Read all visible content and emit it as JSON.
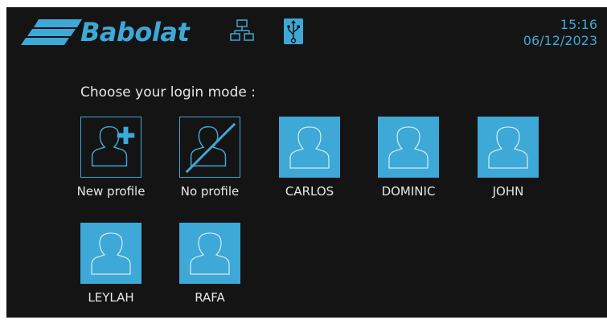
{
  "header": {
    "brand": "Babolat",
    "time": "15:16",
    "date": "06/12/2023"
  },
  "prompt": "Choose your login mode :",
  "profiles": [
    {
      "label": "New profile",
      "icon": "add-user-icon",
      "style": "outline"
    },
    {
      "label": "No profile",
      "icon": "no-user-icon",
      "style": "outline"
    },
    {
      "label": "CARLOS",
      "icon": "user-icon",
      "style": "filled"
    },
    {
      "label": "DOMINIC",
      "icon": "user-icon",
      "style": "filled"
    },
    {
      "label": "JOHN",
      "icon": "user-icon",
      "style": "filled"
    },
    {
      "label": "LEYLAH",
      "icon": "user-icon",
      "style": "filled"
    },
    {
      "label": "RAFA",
      "icon": "user-icon",
      "style": "filled"
    }
  ],
  "colors": {
    "accent": "#3ea8d6",
    "background": "#141414",
    "text": "#e6e6e6"
  }
}
